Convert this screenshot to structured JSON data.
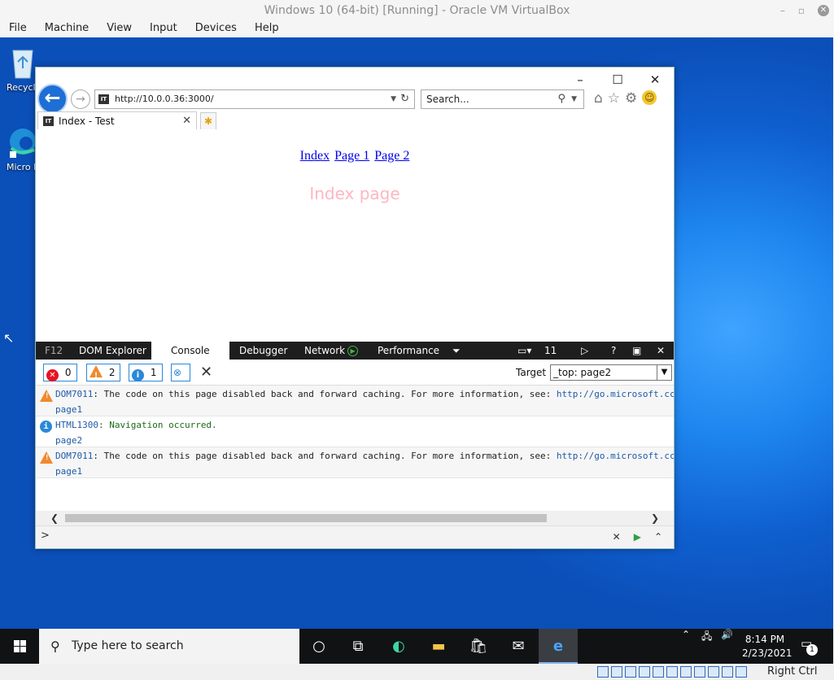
{
  "vbox": {
    "title": "Windows 10 (64-bit) [Running] - Oracle VM VirtualBox",
    "menu": [
      "File",
      "Machine",
      "View",
      "Input",
      "Devices",
      "Help"
    ],
    "status_host_key": "Right Ctrl"
  },
  "desktop": {
    "icons": [
      {
        "label": "Recycl",
        "icon": "recycle-bin-icon"
      },
      {
        "label": "Micro Edg",
        "icon": "edge-icon"
      }
    ]
  },
  "ie": {
    "address": "http://10.0.0.36:3000/",
    "search_placeholder": "Search...",
    "tab_title": "Index - Test",
    "site_icon_text": "IT",
    "page": {
      "nav_links": [
        "Index",
        "Page 1",
        "Page 2"
      ],
      "heading": "Index page",
      "heading_color": "#ffb6c1"
    }
  },
  "f12": {
    "tabs": {
      "f12": "F12",
      "dom": "DOM Explorer",
      "console": "Console",
      "debugger": "Debugger",
      "network": "Network",
      "performance": "Performance",
      "emulation_version": "11"
    },
    "filters": {
      "errors": "0",
      "warnings": "2",
      "info": "1"
    },
    "target_label": "Target",
    "target_value": "_top: page2",
    "messages": [
      {
        "level": "warning",
        "code": "DOM7011",
        "text": ": The code on this page disabled back and forward caching. For more information, see: ",
        "link": "http://go.microsoft.cc",
        "source": "page1"
      },
      {
        "level": "info",
        "code": "HTML1300",
        "text": ": Navigation occurred.",
        "link": "",
        "source": "page2"
      },
      {
        "level": "warning",
        "code": "DOM7011",
        "text": ": The code on this page disabled back and forward caching. For more information, see: ",
        "link": "http://go.microsoft.cc",
        "source": "page1"
      }
    ],
    "prompt": ">"
  },
  "taskbar": {
    "search_placeholder": "Type here to search",
    "time": "8:14 PM",
    "date": "2/23/2021",
    "notifications": "1"
  }
}
